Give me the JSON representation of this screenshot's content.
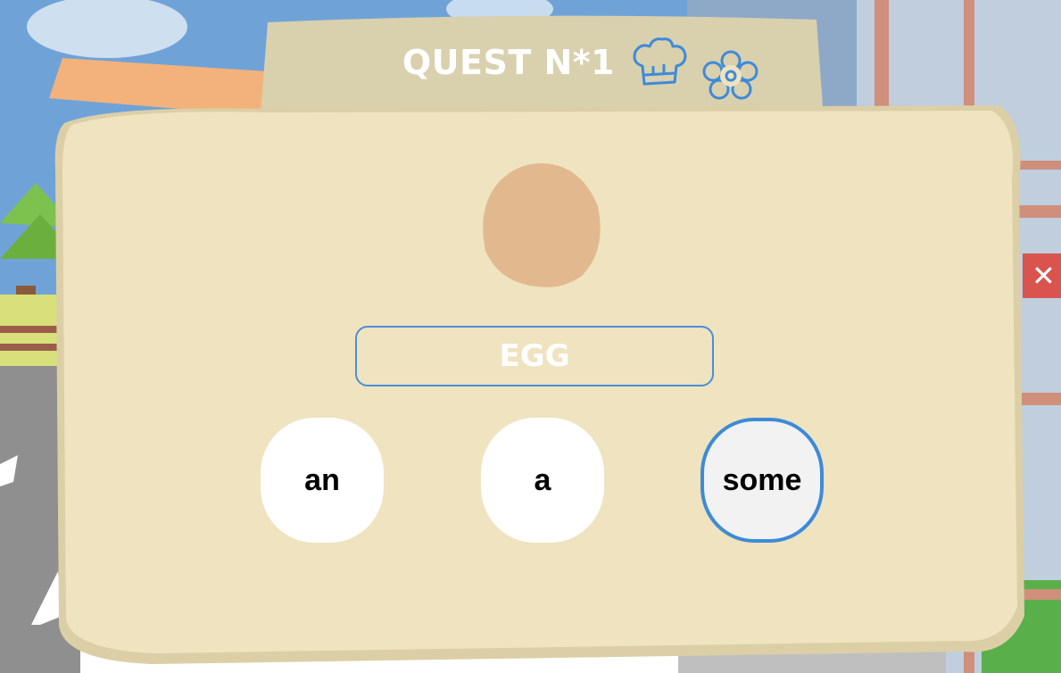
{
  "quest": {
    "title": "QUEST N*1",
    "word": "EGG",
    "choices": [
      {
        "label": "an",
        "selected": false
      },
      {
        "label": "a",
        "selected": false
      },
      {
        "label": "some",
        "selected": true
      }
    ]
  },
  "close_button": {
    "symbol": "✕"
  },
  "icons": [
    "chef-hat-icon",
    "flower-icon",
    "egg-icon"
  ],
  "colors": {
    "panel": "#efe3c0",
    "panel_header": "#d9d0ae",
    "accent_blue": "#3d8bd8",
    "close_red": "#d9534f",
    "egg": "#e2b98e"
  }
}
